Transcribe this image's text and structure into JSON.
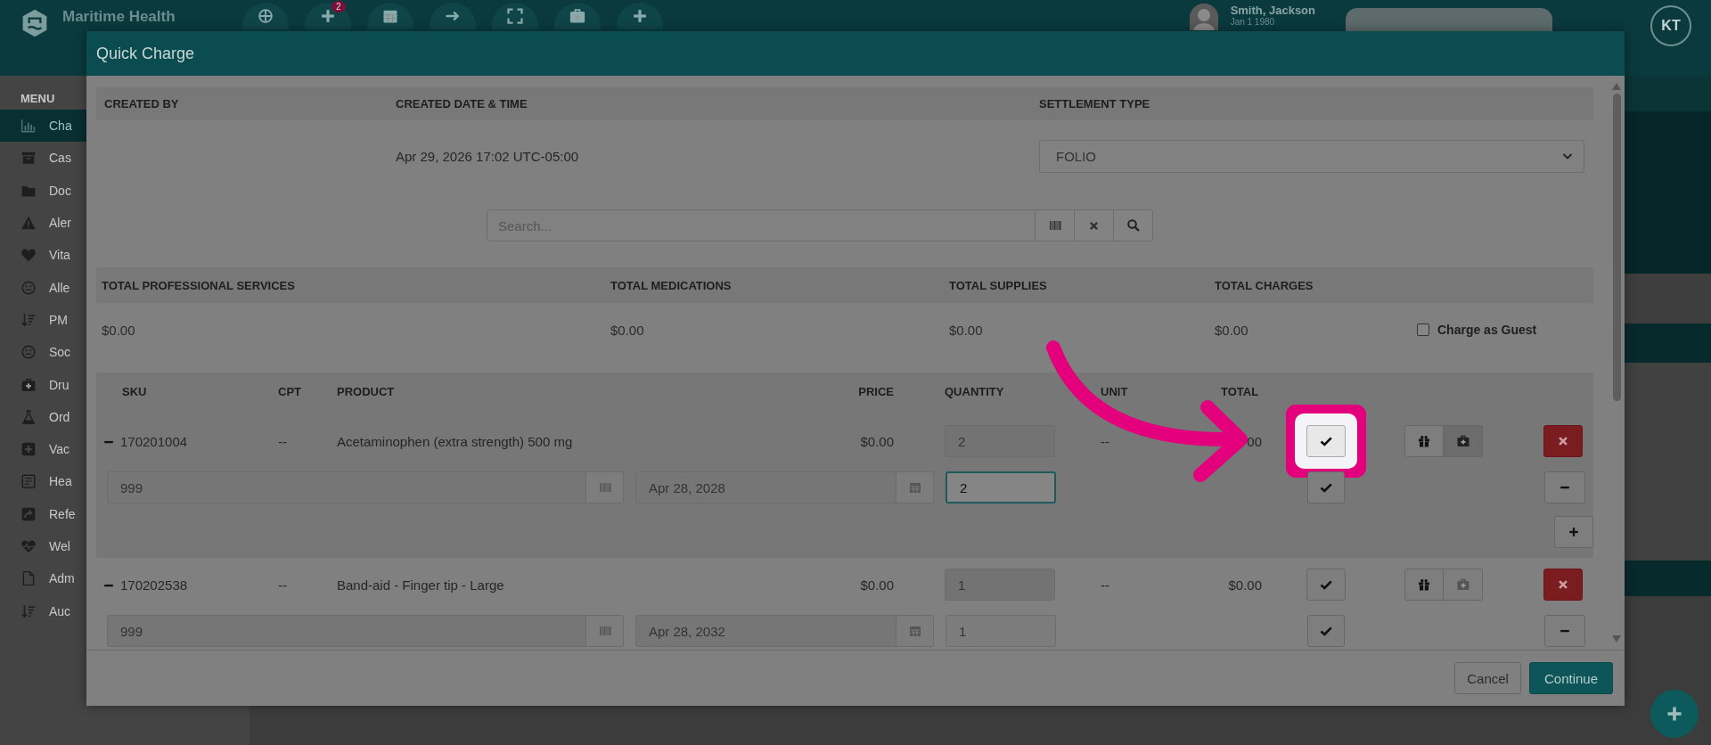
{
  "header": {
    "brand": "Maritime Health",
    "nav_badge": "2",
    "patient_name": "Smith, Jackson",
    "patient_dob": "Jan 1 1980",
    "user_initials": "KT"
  },
  "sidebar": {
    "title": "MENU",
    "items": [
      {
        "label": "Cha",
        "selected": true
      },
      {
        "label": "Cas",
        "selected": false
      },
      {
        "label": "Doc",
        "selected": false
      },
      {
        "label": "Aler",
        "selected": false
      },
      {
        "label": "Vita",
        "selected": false
      },
      {
        "label": "Alle",
        "selected": false
      },
      {
        "label": "PM",
        "selected": false
      },
      {
        "label": "Soc",
        "selected": false
      },
      {
        "label": "Dru",
        "selected": false
      },
      {
        "label": "Ord",
        "selected": false
      },
      {
        "label": "Vac",
        "selected": false
      },
      {
        "label": "Hea",
        "selected": false
      },
      {
        "label": "Refe",
        "selected": false
      },
      {
        "label": "Wel",
        "selected": false
      },
      {
        "label": "Adm",
        "selected": false
      },
      {
        "label": "Auc",
        "selected": false
      }
    ]
  },
  "modal": {
    "title": "Quick Charge",
    "info": {
      "columns": [
        "CREATED BY",
        "CREATED DATE & TIME",
        "SETTLEMENT TYPE"
      ],
      "created_date": "Apr 29, 2026 17:02 UTC-05:00",
      "settlement_type": "FOLIO"
    },
    "search": {
      "placeholder": "Search..."
    },
    "totals": {
      "columns": [
        "TOTAL PROFESSIONAL SERVICES",
        "TOTAL MEDICATIONS",
        "TOTAL SUPPLIES",
        "TOTAL CHARGES"
      ],
      "values": [
        "$0.00",
        "$0.00",
        "$0.00",
        "$0.00"
      ],
      "charge_as_guest": {
        "label": "Charge as Guest",
        "checked": false
      }
    },
    "items": {
      "columns": [
        "SKU",
        "CPT",
        "PRODUCT",
        "PRICE",
        "QUANTITY",
        "UNIT",
        "TOTAL"
      ],
      "rows": [
        {
          "sku": "170201004",
          "cpt": "--",
          "product": "Acetaminophen (extra strength) 500 mg",
          "price": "$0.00",
          "quantity": "2",
          "unit": "--",
          "total": "00",
          "selected": true,
          "highlighted": true,
          "medkit_selected": true,
          "lots": [
            {
              "lot": "999",
              "expiry": "Apr 28, 2028",
              "quantity": "2",
              "focused": true
            }
          ]
        },
        {
          "sku": "170202538",
          "cpt": "--",
          "product": "Band-aid - Finger tip - Large",
          "price": "$0.00",
          "quantity": "1",
          "unit": "--",
          "total": "$0.00",
          "selected": false,
          "highlighted": false,
          "medkit_selected": false,
          "lots": [
            {
              "lot": "999",
              "expiry": "Apr 28, 2032",
              "quantity": "1",
              "focused": false
            }
          ]
        }
      ]
    },
    "buttons": {
      "cancel": "Cancel",
      "continue": "Continue"
    }
  }
}
